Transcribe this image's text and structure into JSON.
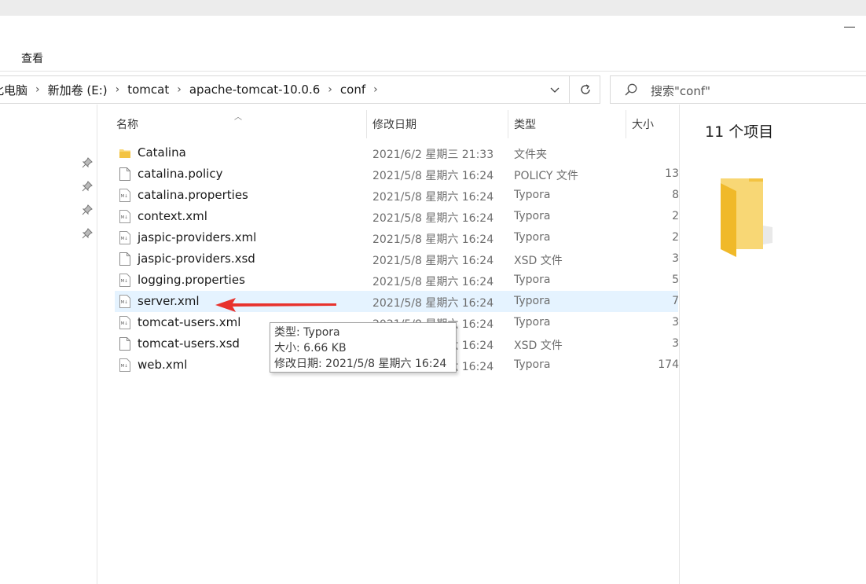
{
  "ribbon": {
    "view_tab": "查看"
  },
  "address": {
    "breadcrumbs": [
      "此电脑",
      "新加卷 (E:)",
      "tomcat",
      "apache-tomcat-10.0.6",
      "conf"
    ],
    "separator": "›"
  },
  "search": {
    "placeholder": "搜索\"conf\""
  },
  "columns": {
    "name": "名称",
    "date": "修改日期",
    "type": "类型",
    "size": "大小"
  },
  "files": [
    {
      "name": "Catalina",
      "date": "2021/6/2 星期三 21:33",
      "type": "文件夹",
      "size": "",
      "icon": "folder-icon"
    },
    {
      "name": "catalina.policy",
      "date": "2021/5/8 星期六 16:24",
      "type": "POLICY 文件",
      "size": "13",
      "icon": "file-icon"
    },
    {
      "name": "catalina.properties",
      "date": "2021/5/8 星期六 16:24",
      "type": "Typora",
      "size": "8",
      "icon": "markdown-file-icon"
    },
    {
      "name": "context.xml",
      "date": "2021/5/8 星期六 16:24",
      "type": "Typora",
      "size": "2",
      "icon": "markdown-file-icon"
    },
    {
      "name": "jaspic-providers.xml",
      "date": "2021/5/8 星期六 16:24",
      "type": "Typora",
      "size": "2",
      "icon": "markdown-file-icon"
    },
    {
      "name": "jaspic-providers.xsd",
      "date": "2021/5/8 星期六 16:24",
      "type": "XSD 文件",
      "size": "3",
      "icon": "file-icon"
    },
    {
      "name": "logging.properties",
      "date": "2021/5/8 星期六 16:24",
      "type": "Typora",
      "size": "5",
      "icon": "markdown-file-icon"
    },
    {
      "name": "server.xml",
      "date": "2021/5/8 星期六 16:24",
      "type": "Typora",
      "size": "7",
      "icon": "markdown-file-icon"
    },
    {
      "name": "tomcat-users.xml",
      "date": "2021/5/8 星期六 16:24",
      "type": "Typora",
      "size": "3",
      "icon": "markdown-file-icon"
    },
    {
      "name": "tomcat-users.xsd",
      "date": "2021/5/8 星期六 16:24",
      "type": "XSD 文件",
      "size": "3",
      "icon": "file-icon"
    },
    {
      "name": "web.xml",
      "date": "2021/5/8 星期六 16:24",
      "type": "Typora",
      "size": "174",
      "icon": "markdown-file-icon"
    }
  ],
  "tooltip": {
    "type_line": "类型: Typora",
    "size_line": "大小: 6.66 KB",
    "date_line": "修改日期: 2021/5/8 星期六 16:24"
  },
  "details": {
    "item_count": "11 个项目"
  },
  "colors": {
    "selected_row": "#e5f3ff",
    "annotation_arrow": "#e8322d",
    "folder_yellow": "#f8d775"
  }
}
